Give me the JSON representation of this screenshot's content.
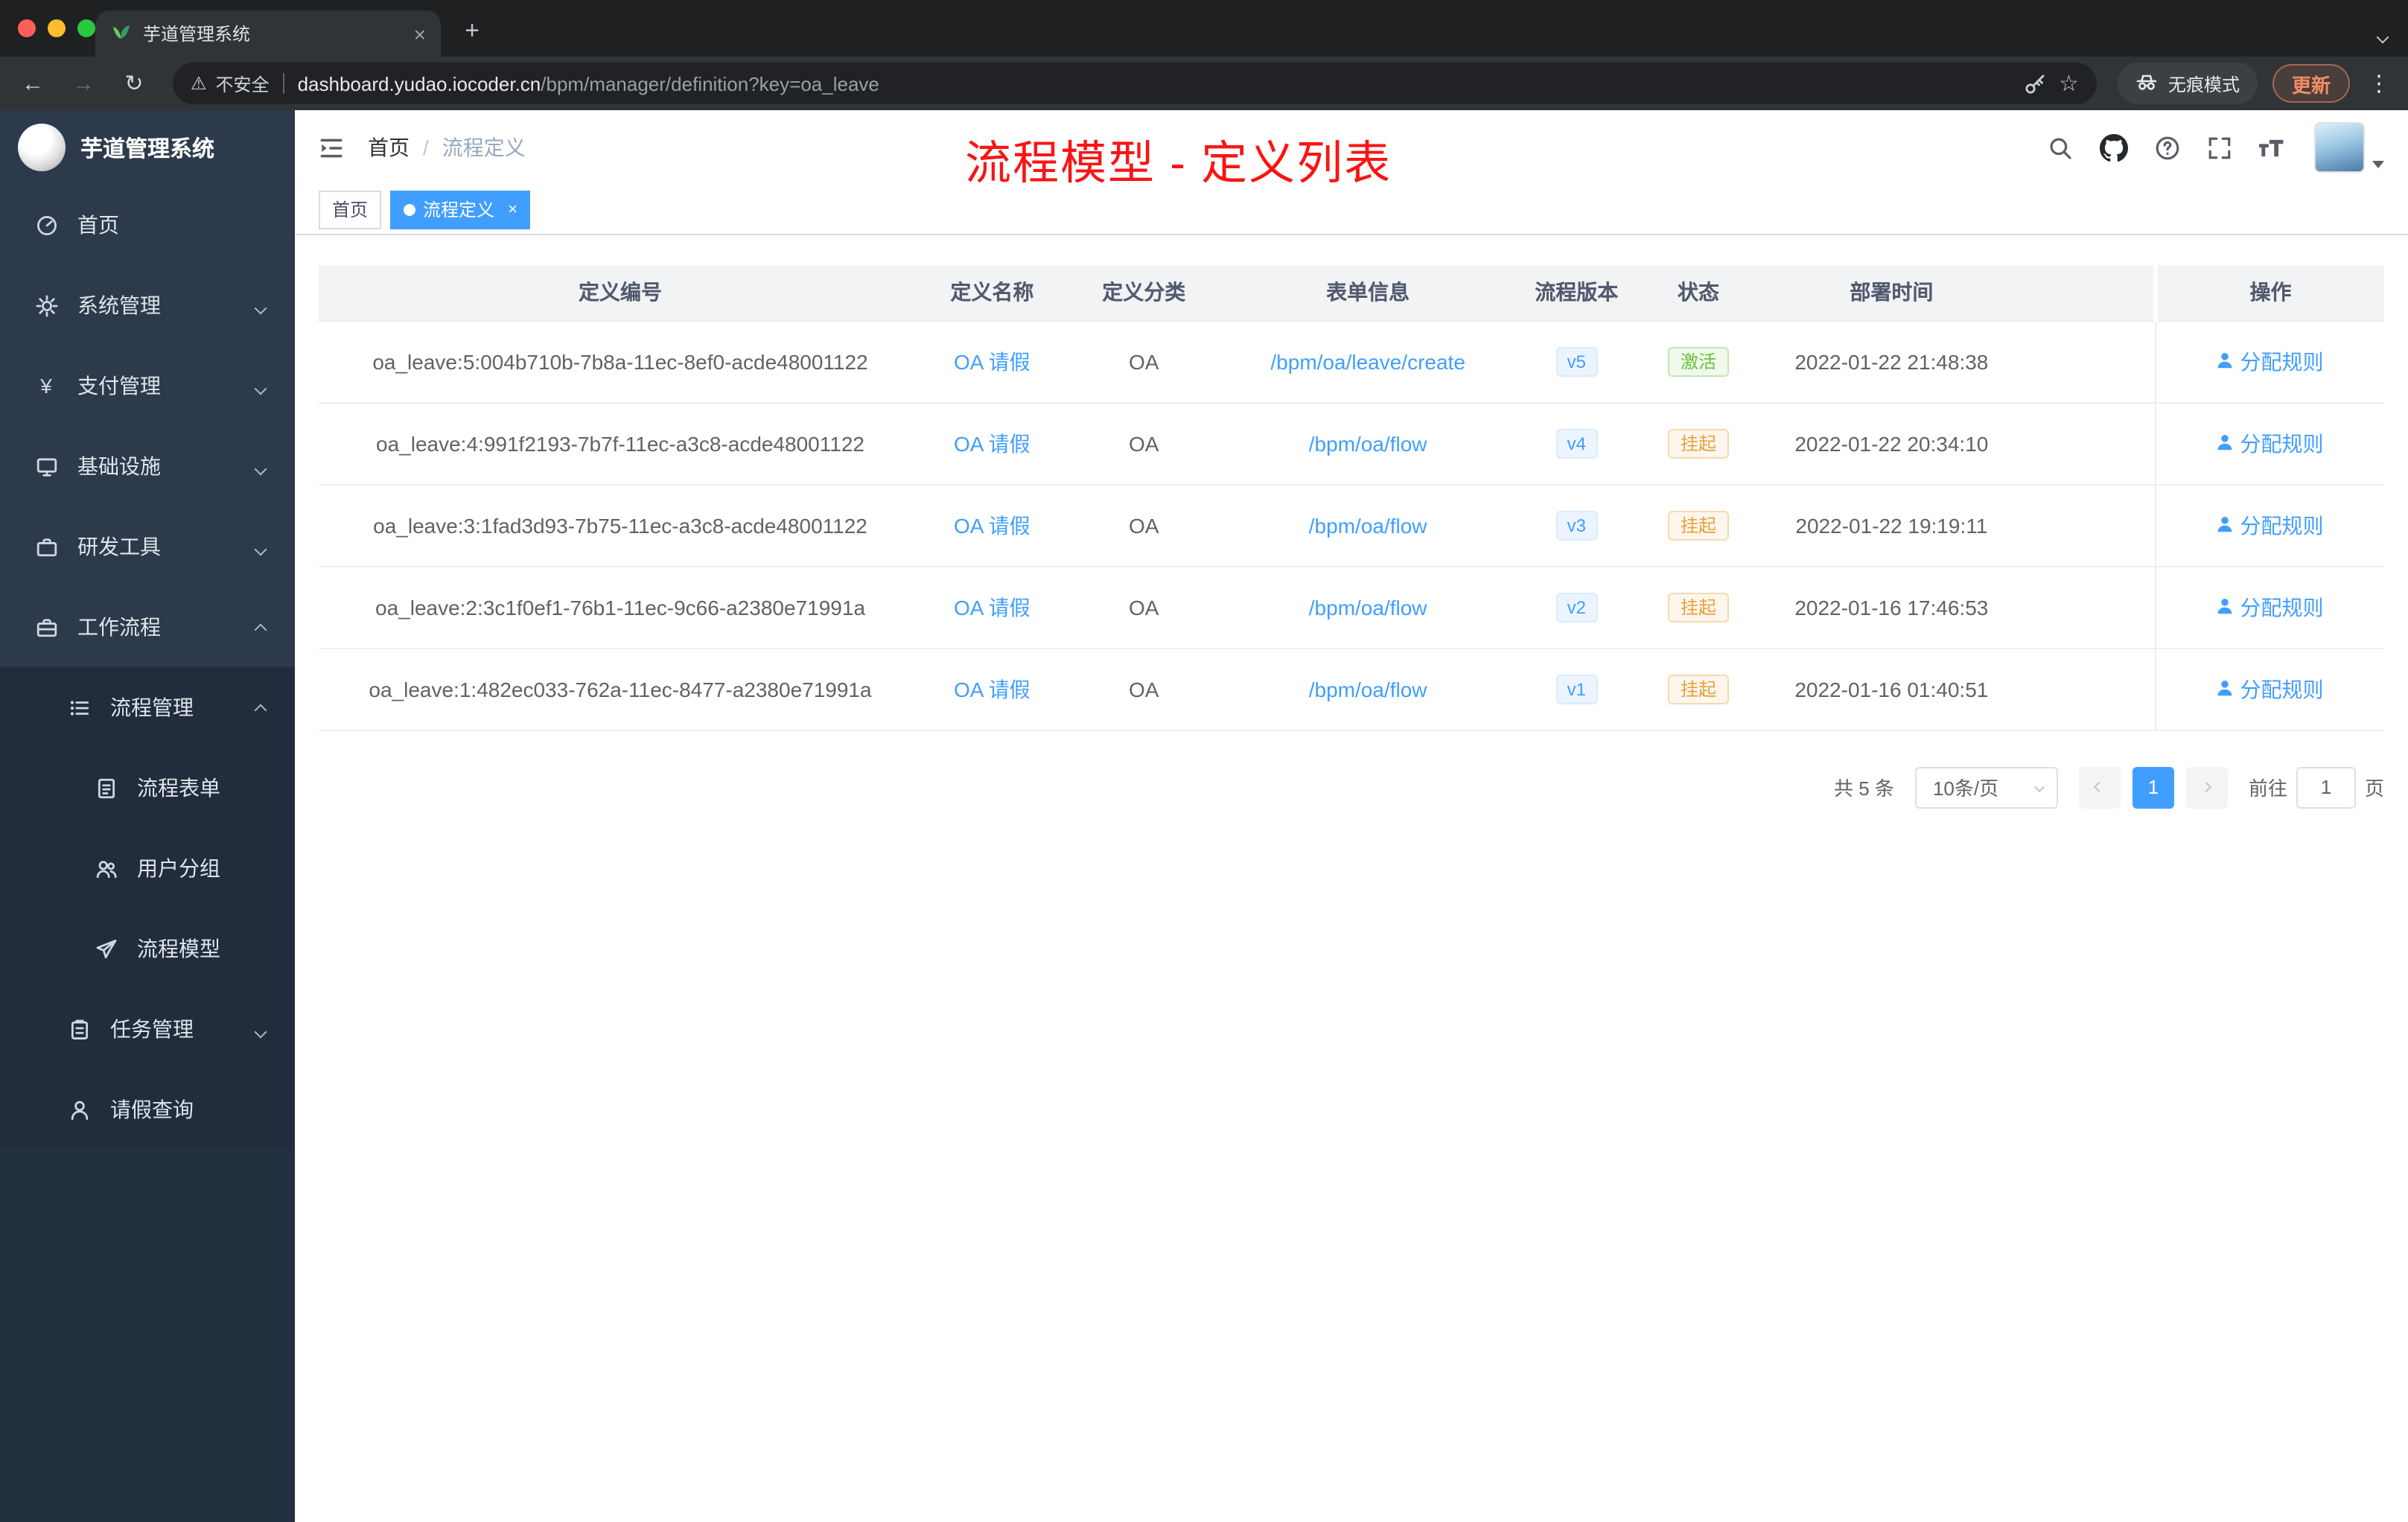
{
  "browser": {
    "tab_title": "芋道管理系统",
    "security_label": "不安全",
    "url_host": "dashboard.yudao.iocoder.cn",
    "url_path": "/bpm/manager/definition?key=oa_leave",
    "incognito_label": "无痕模式",
    "update_label": "更新"
  },
  "icons": {
    "back": "←",
    "forward": "→",
    "reload": "↻",
    "warning_triangle": "⚠",
    "tab_close": "×",
    "new_tab": "+",
    "kebab_menu": "⋮",
    "star": "☆",
    "yen": "¥",
    "tag_close": "×"
  },
  "sidebar": {
    "logo_title": "芋道管理系统",
    "items": [
      {
        "label": "首页",
        "icon": "dashboard-icon"
      },
      {
        "label": "系统管理",
        "icon": "gear-icon"
      },
      {
        "label": "支付管理",
        "icon": "yen-icon"
      },
      {
        "label": "基础设施",
        "icon": "infrastructure-icon"
      },
      {
        "label": "研发工具",
        "icon": "tools-icon"
      },
      {
        "label": "工作流程",
        "icon": "workflow-icon"
      },
      {
        "label": "流程管理",
        "icon": "process-list-icon"
      },
      {
        "label": "流程表单",
        "icon": "form-icon"
      },
      {
        "label": "用户分组",
        "icon": "user-group-icon"
      },
      {
        "label": "流程模型",
        "icon": "paper-plane-icon"
      },
      {
        "label": "任务管理",
        "icon": "task-icon"
      },
      {
        "label": "请假查询",
        "icon": "person-icon"
      }
    ]
  },
  "header": {
    "breadcrumb_home": "首页",
    "breadcrumb_separator": "/",
    "breadcrumb_current": "流程定义"
  },
  "overlay_title": "流程模型 - 定义列表",
  "tags": [
    {
      "label": "首页",
      "active": false
    },
    {
      "label": "流程定义",
      "active": true
    }
  ],
  "table": {
    "columns": [
      "定义编号",
      "定义名称",
      "定义分类",
      "表单信息",
      "流程版本",
      "状态",
      "部署时间",
      "操作"
    ],
    "rows": [
      {
        "id": "oa_leave:5:004b710b-7b8a-11ec-8ef0-acde48001122",
        "name": "OA 请假",
        "category": "OA",
        "form": "/bpm/oa/leave/create",
        "version": "v5",
        "status": "激活",
        "time": "2022-01-22 21:48:38",
        "op": "分配规则"
      },
      {
        "id": "oa_leave:4:991f2193-7b7f-11ec-a3c8-acde48001122",
        "name": "OA 请假",
        "category": "OA",
        "form": "/bpm/oa/flow",
        "version": "v4",
        "status": "挂起",
        "time": "2022-01-22 20:34:10",
        "op": "分配规则"
      },
      {
        "id": "oa_leave:3:1fad3d93-7b75-11ec-a3c8-acde48001122",
        "name": "OA 请假",
        "category": "OA",
        "form": "/bpm/oa/flow",
        "version": "v3",
        "status": "挂起",
        "time": "2022-01-22 19:19:11",
        "op": "分配规则"
      },
      {
        "id": "oa_leave:2:3c1f0ef1-76b1-11ec-9c66-a2380e71991a",
        "name": "OA 请假",
        "category": "OA",
        "form": "/bpm/oa/flow",
        "version": "v2",
        "status": "挂起",
        "time": "2022-01-16 17:46:53",
        "op": "分配规则"
      },
      {
        "id": "oa_leave:1:482ec033-762a-11ec-8477-a2380e71991a",
        "name": "OA 请假",
        "category": "OA",
        "form": "/bpm/oa/flow",
        "version": "v1",
        "status": "挂起",
        "time": "2022-01-16 01:40:51",
        "op": "分配规则"
      }
    ]
  },
  "pagination": {
    "total": "共 5 条",
    "page_size": "10条/页",
    "current_page": "1",
    "goto_label": "前往",
    "goto_value": "1",
    "page_label": "页"
  },
  "colors": {
    "accent": "#409EFF",
    "success": "#67C23A",
    "warning": "#E6A23C",
    "title_red": "#FA1414",
    "sidebar_bg": "#2D3A4B",
    "sidebar_submenu_bg": "#212D3C"
  }
}
